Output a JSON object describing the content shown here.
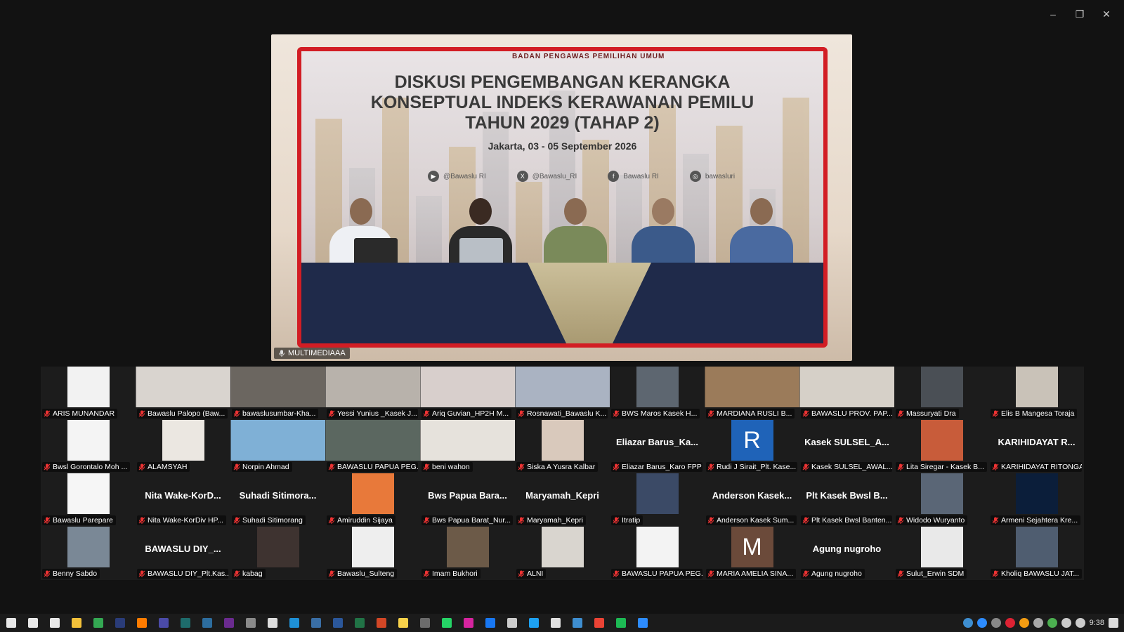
{
  "window": {
    "minimize": "–",
    "restore": "❐",
    "close": "✕"
  },
  "speaker": {
    "banner_logo": "BADAN PENGAWAS PEMILIHAN UMUM",
    "title_lines": [
      "DISKUSI PENGEMBANGAN KERANGKA",
      "KONSEPTUAL INDEKS KERAWANAN PEMILU",
      "TAHUN 2029 (TAHAP 2)"
    ],
    "date": "Jakarta, 03 - 05 September 2026",
    "socials": [
      "@Bawaslu RI",
      "@Bawaslu_RI",
      "Bawaslu RI",
      "bawasluri"
    ],
    "label": "MULTIMEDIAAA"
  },
  "participants": [
    {
      "label": "ARIS MUNANDAR",
      "kind": "thumb",
      "color": "#f2f2f2",
      "shape": "sq"
    },
    {
      "label": "Bawaslu Palopo (Baw...",
      "kind": "thumb",
      "color": "#d9d4cf",
      "shape": "wide"
    },
    {
      "label": "bawaslusumbar-Kha...",
      "kind": "thumb",
      "color": "#6b6660",
      "shape": "wide"
    },
    {
      "label": "Yessi Yunius _Kasek J...",
      "kind": "thumb",
      "color": "#b8b2ab",
      "shape": "wide"
    },
    {
      "label": "Ariq Guvian_HP2H M...",
      "kind": "thumb",
      "color": "#d8cfcc",
      "shape": "wide"
    },
    {
      "label": "Rosnawati_Bawaslu K...",
      "kind": "thumb",
      "color": "#aab3c2",
      "shape": "wide"
    },
    {
      "label": "BWS Maros Kasek H...",
      "kind": "thumb",
      "color": "#5d6670",
      "shape": "sq"
    },
    {
      "label": "MARDIANA RUSLI B...",
      "kind": "thumb",
      "color": "#9b7b5a",
      "shape": "wide"
    },
    {
      "label": "BAWASLU PROV. PAP...",
      "kind": "thumb",
      "color": "#d6d0c8",
      "shape": "wide"
    },
    {
      "label": "Massuryati Dra",
      "kind": "thumb",
      "color": "#4a4f55",
      "shape": "sq"
    },
    {
      "label": "Elis B Mangesa Toraja",
      "kind": "thumb",
      "color": "#c9c2b8",
      "shape": "sq"
    },
    {
      "label": "Bwsl Gorontalo Moh ...",
      "kind": "thumb",
      "color": "#f4f4f4",
      "shape": "sq"
    },
    {
      "label": "ALAMSYAH",
      "kind": "thumb",
      "color": "#ebe7e1",
      "shape": "sq"
    },
    {
      "label": "Norpin Ahmad",
      "kind": "thumb",
      "color": "#7fb0d6",
      "shape": "wide"
    },
    {
      "label": "BAWASLU PAPUA PEG...",
      "kind": "thumb",
      "color": "#5b6760",
      "shape": "wide"
    },
    {
      "label": "beni wahon",
      "kind": "thumb",
      "color": "#e6e2dc",
      "shape": "wide"
    },
    {
      "label": "Siska A Yusra Kalbar",
      "kind": "thumb",
      "color": "#d9c9bc",
      "shape": "sq"
    },
    {
      "label": "Eliazar Barus_Karo FPP",
      "kind": "name",
      "big": "Eliazar  Barus_Ka..."
    },
    {
      "label": "Rudi J Sirait_Plt. Kase...",
      "kind": "letter",
      "letter": "R",
      "color": "#1f63b8"
    },
    {
      "label": "Kasek SULSEL_AWAL...",
      "kind": "name",
      "big": "Kasek  SULSEL_A..."
    },
    {
      "label": "Lita Siregar - Kasek B...",
      "kind": "thumb",
      "color": "#c85c3a",
      "shape": "sq"
    },
    {
      "label": "KARIHIDAYAT RITONGA",
      "kind": "name",
      "big": "KARIHIDAYAT  R..."
    },
    {
      "label": "Bawaslu Parepare",
      "kind": "thumb",
      "color": "#f6f6f6",
      "shape": "sq"
    },
    {
      "label": "Nita Wake-KorDiv HP...",
      "kind": "name",
      "big": "Nita  Wake-KorD..."
    },
    {
      "label": "Suhadi Sitimorang",
      "kind": "name",
      "big": "Suhadi  Sitimora..."
    },
    {
      "label": "Amiruddin Sijaya",
      "kind": "thumb",
      "color": "#e8793a",
      "shape": "sq"
    },
    {
      "label": "Bws Papua Barat_Nur...",
      "kind": "name",
      "big": "Bws  Papua  Bara..."
    },
    {
      "label": "Maryamah_Kepri",
      "kind": "name",
      "big": "Maryamah_Kepri"
    },
    {
      "label": "Itratip",
      "kind": "thumb",
      "color": "#3b4a66",
      "shape": "sq"
    },
    {
      "label": "Anderson Kasek Sum...",
      "kind": "name",
      "big": "Anderson  Kasek..."
    },
    {
      "label": "Plt Kasek Bwsl Banten...",
      "kind": "name",
      "big": "Plt  Kasek  Bwsl  B..."
    },
    {
      "label": "Widodo Wuryanto",
      "kind": "thumb",
      "color": "#5a6676",
      "shape": "sq"
    },
    {
      "label": "Armeni Sejahtera Kre...",
      "kind": "thumb",
      "color": "#0b1e3a",
      "shape": "sq"
    },
    {
      "label": "Benny Sabdo",
      "kind": "thumb",
      "color": "#7a8896",
      "shape": "sq"
    },
    {
      "label": "BAWASLU DIY_Plt.Kas...",
      "kind": "name",
      "big": "BAWASLU  DIY_..."
    },
    {
      "label": "kabag",
      "kind": "thumb",
      "color": "#3e3330",
      "shape": "sq"
    },
    {
      "label": "Bawaslu_Sulteng",
      "kind": "thumb",
      "color": "#eeeeee",
      "shape": "sq"
    },
    {
      "label": "Imam Bukhori",
      "kind": "thumb",
      "color": "#6c5a48",
      "shape": "sq"
    },
    {
      "label": "ALNI",
      "kind": "thumb",
      "color": "#d9d5cf",
      "shape": "sq"
    },
    {
      "label": "BAWASLU PAPUA PEG...",
      "kind": "thumb",
      "color": "#f3f3f3",
      "shape": "sq"
    },
    {
      "label": "MARIA AMELIA SINA...",
      "kind": "letter",
      "letter": "M",
      "color": "#6b4a3a"
    },
    {
      "label": "Agung nugroho",
      "kind": "name",
      "big": "Agung  nugroho"
    },
    {
      "label": "Sulut_Erwin SDM",
      "kind": "thumb",
      "color": "#e9e9e9",
      "shape": "sq"
    },
    {
      "label": "Kholiq BAWASLU JAT...",
      "kind": "thumb",
      "color": "#4f5d70",
      "shape": "sq"
    }
  ],
  "taskbar": {
    "apps": [
      {
        "name": "windows-start",
        "color": "#e8e8e8"
      },
      {
        "name": "search",
        "color": "#e8e8e8"
      },
      {
        "name": "task-view",
        "color": "#e8e8e8"
      },
      {
        "name": "file-explorer",
        "color": "#f3c13a"
      },
      {
        "name": "chrome",
        "color": "#34a853"
      },
      {
        "name": "photoshop",
        "color": "#2a3c78"
      },
      {
        "name": "illustrator",
        "color": "#ff7c00"
      },
      {
        "name": "after-effects",
        "color": "#4b4ba8"
      },
      {
        "name": "audition",
        "color": "#1e6b6b"
      },
      {
        "name": "lightroom",
        "color": "#2d6d9e"
      },
      {
        "name": "premiere",
        "color": "#6a2b8f"
      },
      {
        "name": "inkscape",
        "color": "#8a8a8a"
      },
      {
        "name": "notes",
        "color": "#dddddd"
      },
      {
        "name": "edge",
        "color": "#1e90d6"
      },
      {
        "name": "terminal",
        "color": "#3a6ea5"
      },
      {
        "name": "word",
        "color": "#2b579a"
      },
      {
        "name": "excel",
        "color": "#217346"
      },
      {
        "name": "powerpoint",
        "color": "#d24726"
      },
      {
        "name": "sticky-notes",
        "color": "#f7d14a"
      },
      {
        "name": "calculator",
        "color": "#6b6b6b"
      },
      {
        "name": "whatsapp",
        "color": "#25d366"
      },
      {
        "name": "instagram",
        "color": "#d6249f"
      },
      {
        "name": "facebook",
        "color": "#1877f2"
      },
      {
        "name": "threads",
        "color": "#cccccc"
      },
      {
        "name": "twitter",
        "color": "#1da1f2"
      },
      {
        "name": "tiktok",
        "color": "#e0e0e0"
      },
      {
        "name": "photos",
        "color": "#3e8ed0"
      },
      {
        "name": "store",
        "color": "#ea4335"
      },
      {
        "name": "spotify",
        "color": "#1db954"
      },
      {
        "name": "zoom",
        "color": "#2d8cff"
      }
    ],
    "clock": "9:38"
  }
}
